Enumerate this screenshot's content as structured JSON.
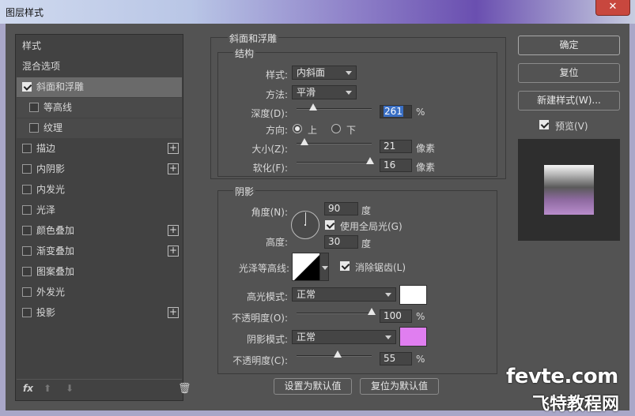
{
  "window": {
    "title": "图层样式",
    "close_glyph": "✕"
  },
  "sidebar": {
    "items": [
      {
        "label": "样式",
        "checkbox": false,
        "plus": false,
        "checked": false,
        "sub": false,
        "selected": false
      },
      {
        "label": "混合选项",
        "checkbox": false,
        "plus": false,
        "checked": false,
        "sub": false,
        "selected": false
      },
      {
        "label": "斜面和浮雕",
        "checkbox": true,
        "plus": false,
        "checked": true,
        "sub": false,
        "selected": true
      },
      {
        "label": "等高线",
        "checkbox": true,
        "plus": false,
        "checked": false,
        "sub": true,
        "selected": false
      },
      {
        "label": "纹理",
        "checkbox": true,
        "plus": false,
        "checked": false,
        "sub": true,
        "selected": false
      },
      {
        "label": "描边",
        "checkbox": true,
        "plus": true,
        "checked": false,
        "sub": false,
        "selected": false
      },
      {
        "label": "内阴影",
        "checkbox": true,
        "plus": true,
        "checked": false,
        "sub": false,
        "selected": false
      },
      {
        "label": "内发光",
        "checkbox": true,
        "plus": false,
        "checked": false,
        "sub": false,
        "selected": false
      },
      {
        "label": "光泽",
        "checkbox": true,
        "plus": false,
        "checked": false,
        "sub": false,
        "selected": false
      },
      {
        "label": "颜色叠加",
        "checkbox": true,
        "plus": true,
        "checked": false,
        "sub": false,
        "selected": false
      },
      {
        "label": "渐变叠加",
        "checkbox": true,
        "plus": true,
        "checked": false,
        "sub": false,
        "selected": false
      },
      {
        "label": "图案叠加",
        "checkbox": true,
        "plus": false,
        "checked": false,
        "sub": false,
        "selected": false
      },
      {
        "label": "外发光",
        "checkbox": true,
        "plus": false,
        "checked": false,
        "sub": false,
        "selected": false
      },
      {
        "label": "投影",
        "checkbox": true,
        "plus": true,
        "checked": false,
        "sub": false,
        "selected": false
      }
    ],
    "fx_label": "fx",
    "plus_glyph": "+",
    "up_glyph": "⬆",
    "down_glyph": "⬇",
    "trash_glyph": "🗑"
  },
  "bevel": {
    "section_title": "斜面和浮雕",
    "structure_title": "结构",
    "style_label": "样式:",
    "style_value": "内斜面",
    "technique_label": "方法:",
    "technique_value": "平滑",
    "depth_label": "深度(D):",
    "depth_value": "261",
    "depth_unit": "%",
    "depth_slider": 0.22,
    "direction_label": "方向:",
    "direction_up": "上",
    "direction_down": "下",
    "size_label": "大小(Z):",
    "size_value": "21",
    "size_unit": "像素",
    "size_slider": 0.1,
    "soften_label": "软化(F):",
    "soften_value": "16",
    "soften_unit": "像素",
    "soften_slider": 0.98
  },
  "shading": {
    "title": "阴影",
    "angle_label": "角度(N):",
    "angle_value": "90",
    "angle_unit": "度",
    "global_light_label": "使用全局光(G)",
    "altitude_label": "高度:",
    "altitude_value": "30",
    "altitude_unit": "度",
    "gloss_contour_label": "光泽等高线:",
    "anti_alias_label": "消除锯齿(L)",
    "highlight_mode_label": "高光模式:",
    "highlight_mode_value": "正常",
    "highlight_color": "#ffffff",
    "highlight_opacity_label": "不透明度(O):",
    "highlight_opacity_value": "100",
    "highlight_opacity_unit": "%",
    "highlight_opacity_slider": 1.0,
    "shadow_mode_label": "阴影模式:",
    "shadow_mode_value": "正常",
    "shadow_color": "#e07ef0",
    "shadow_opacity_label": "不透明度(C):",
    "shadow_opacity_value": "55",
    "shadow_opacity_unit": "%",
    "shadow_opacity_slider": 0.55
  },
  "footer": {
    "make_default": "设置为默认值",
    "reset_default": "复位为默认值"
  },
  "right": {
    "ok": "确定",
    "reset": "复位",
    "new_style": "新建样式(W)...",
    "preview_label": "预览(V)"
  },
  "watermark": {
    "line1": "fevte.com",
    "line2": "飞特教程网"
  }
}
